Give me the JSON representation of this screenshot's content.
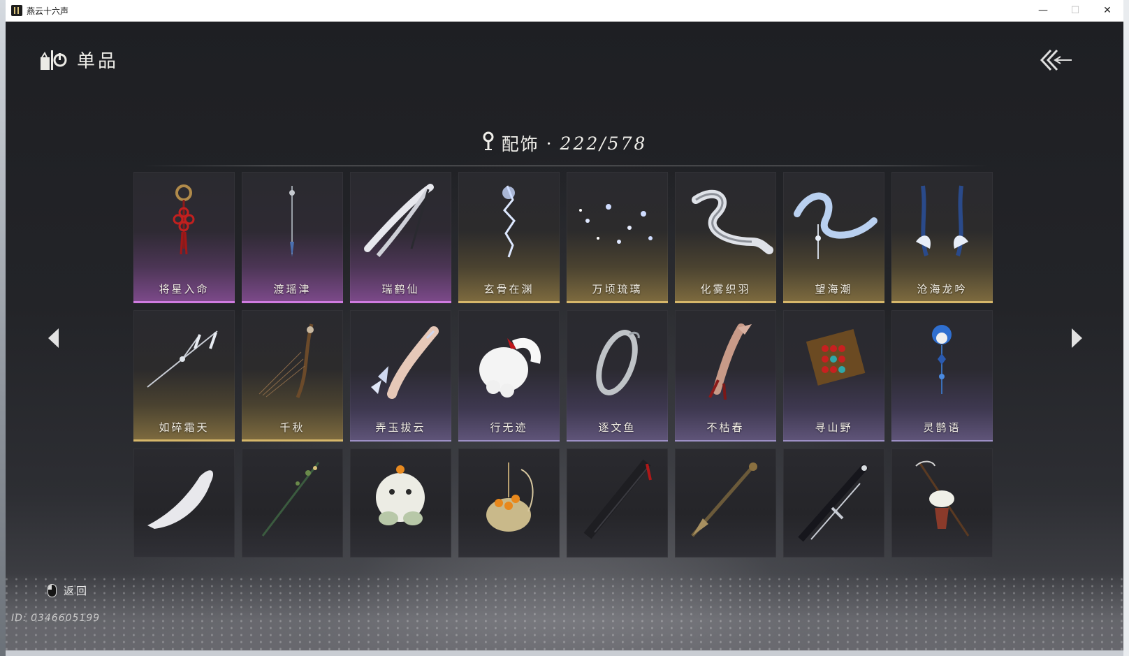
{
  "window": {
    "title": "燕云十六声",
    "controls": {
      "minimize": "—",
      "maximize": "☐",
      "close": "✕"
    }
  },
  "header": {
    "title": "单品",
    "icon": "collection-icon",
    "back_icon": "double-chevron-back-icon"
  },
  "section": {
    "icon": "location-pin-icon",
    "name": "配饰",
    "separator": "·",
    "count": "222/578"
  },
  "nav": {
    "prev_icon": "triangle-left-icon",
    "next_icon": "triangle-right-icon"
  },
  "grid": {
    "rows": [
      [
        {
          "label": "将星入命",
          "rarity": "purple",
          "art": "red-knot-pendant"
        },
        {
          "label": "渡瑶津",
          "rarity": "purple",
          "art": "slim-hairpin"
        },
        {
          "label": "瑞鹤仙",
          "rarity": "purple",
          "art": "white-whisk"
        },
        {
          "label": "玄骨在渊",
          "rarity": "gold",
          "art": "lightning-sparkle"
        },
        {
          "label": "万顷琉璃",
          "rarity": "gold",
          "art": "starry-particles"
        },
        {
          "label": "化雾织羽",
          "rarity": "gold",
          "art": "silver-ribbon"
        },
        {
          "label": "望海潮",
          "rarity": "gold",
          "art": "blue-wave-ribbon"
        },
        {
          "label": "沧海龙吟",
          "rarity": "gold",
          "art": "blue-dragon-horns"
        }
      ],
      [
        {
          "label": "如碎霜天",
          "rarity": "gold",
          "art": "frost-branch"
        },
        {
          "label": "千秋",
          "rarity": "gold",
          "art": "harp-branch"
        },
        {
          "label": "弄玉拔云",
          "rarity": "violet",
          "art": "crystal-hand"
        },
        {
          "label": "行无迹",
          "rarity": "violet",
          "art": "white-paw"
        },
        {
          "label": "逐文鱼",
          "rarity": "violet",
          "art": "silver-ring"
        },
        {
          "label": "不枯春",
          "rarity": "violet",
          "art": "bone-claw"
        },
        {
          "label": "寻山野",
          "rarity": "violet",
          "art": "abacus"
        },
        {
          "label": "灵鹊语",
          "rarity": "violet",
          "art": "blue-bird"
        }
      ],
      [
        {
          "label": "",
          "rarity": "none",
          "art": "white-tail"
        },
        {
          "label": "",
          "rarity": "none",
          "art": "green-branch"
        },
        {
          "label": "",
          "rarity": "none",
          "art": "fluffy-creature"
        },
        {
          "label": "",
          "rarity": "none",
          "art": "fruit-basket"
        },
        {
          "label": "",
          "rarity": "none",
          "art": "black-umbrella"
        },
        {
          "label": "",
          "rarity": "none",
          "art": "bronze-spear"
        },
        {
          "label": "",
          "rarity": "none",
          "art": "black-sword"
        },
        {
          "label": "",
          "rarity": "none",
          "art": "flower-hoe"
        }
      ]
    ]
  },
  "footer": {
    "back_label": "返回",
    "back_icon": "mouse-right-click-icon",
    "player_id": "ID: 0346605199"
  },
  "colors": {
    "purple_edge": "#cf7be0",
    "gold_edge": "#d6b76a",
    "violet_edge": "#9c8fc4",
    "text": "#f1ede4"
  }
}
